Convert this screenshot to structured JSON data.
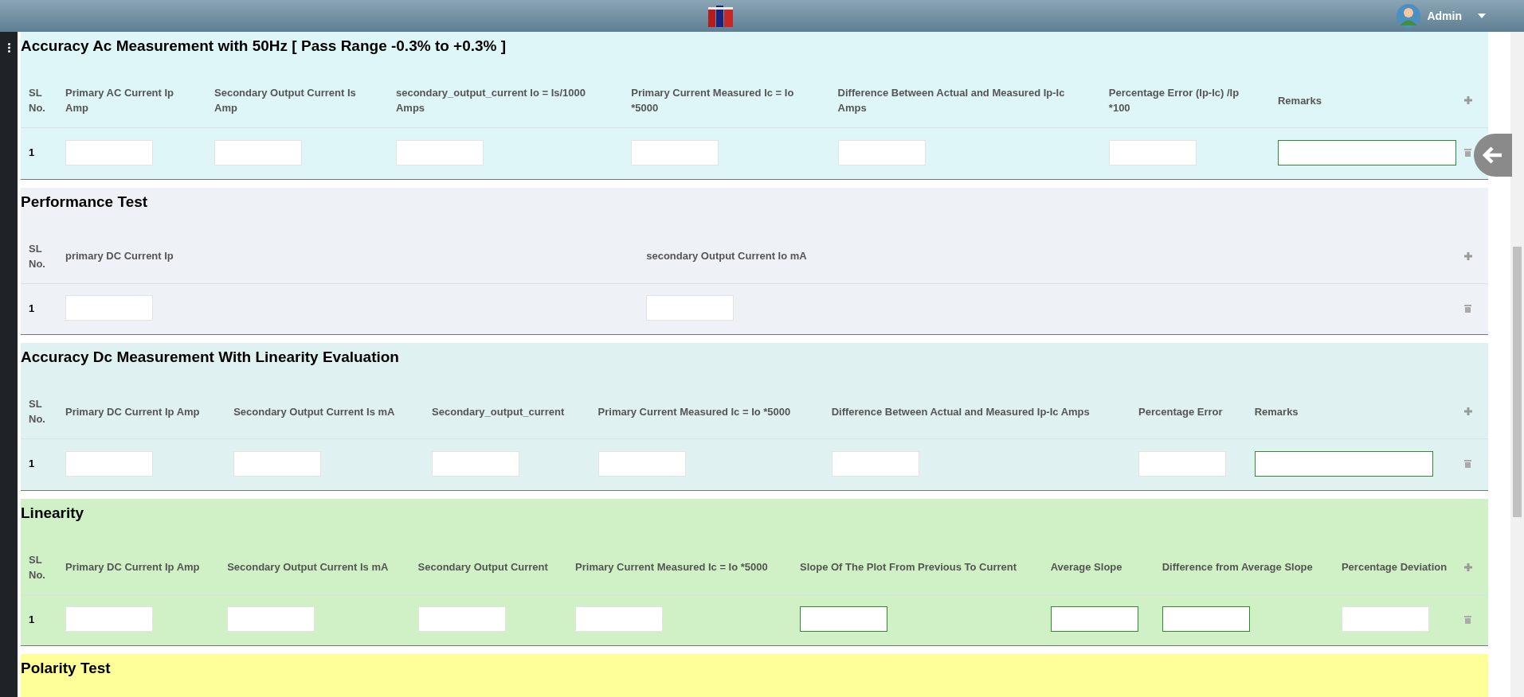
{
  "topbar": {
    "user": "Admin"
  },
  "sections": [
    {
      "title": "Accuracy Ac Measurement with 50Hz [ Pass Range -0.3% to +0.3% ]",
      "color": "#dff6f8",
      "columns": [
        "SL No.",
        "Primary AC Current Ip Amp",
        "Secondary Output Current Is Amp",
        "secondary_output_current Io = Is/1000 Amps",
        "Primary Current Measured Ic = Io *5000",
        "Difference Between Actual and Measured Ip-Ic Amps",
        "Percentage Error (Ip-Ic) /Ip *100",
        "Remarks"
      ],
      "rows": [
        {
          "sl": "1",
          "inputs": [
            {
              "outlined": false
            },
            {
              "outlined": false
            },
            {
              "outlined": false
            },
            {
              "outlined": false
            },
            {
              "outlined": false
            },
            {
              "outlined": false
            },
            {
              "outlined": true,
              "wide": true
            }
          ]
        }
      ]
    },
    {
      "title": "Performance Test",
      "color": "#eef2f7",
      "columns": [
        "SL No.",
        "primary DC Current Ip",
        "secondary Output Current Io mA"
      ],
      "rows": [
        {
          "sl": "1",
          "inputs": [
            {
              "outlined": false
            },
            {
              "outlined": false
            }
          ]
        }
      ]
    },
    {
      "title": "Accuracy Dc Measurement With Linearity Evaluation",
      "color": "#e0f1f1",
      "columns": [
        "SL No.",
        "Primary DC Current Ip Amp",
        "Secondary Output Current Is mA",
        "Secondary_output_current",
        "Primary Current Measured Ic = Io *5000",
        "Difference Between Actual and Measured Ip-Ic Amps",
        "Percentage Error",
        "Remarks"
      ],
      "rows": [
        {
          "sl": "1",
          "inputs": [
            {
              "outlined": false
            },
            {
              "outlined": false
            },
            {
              "outlined": false
            },
            {
              "outlined": false
            },
            {
              "outlined": false
            },
            {
              "outlined": false
            },
            {
              "outlined": true,
              "wide": true
            }
          ]
        }
      ]
    },
    {
      "title": "Linearity",
      "color": "#d0f1c5",
      "columns": [
        "SL No.",
        "Primary DC Current Ip Amp",
        "Secondary Output Current Is mA",
        "Secondary Output Current",
        "Primary Current Measured Ic = Io *5000",
        "Slope Of The Plot From Previous To Current",
        "Average Slope",
        "Difference from Average Slope",
        "Percentage Deviation"
      ],
      "rows": [
        {
          "sl": "1",
          "inputs": [
            {
              "outlined": false
            },
            {
              "outlined": false
            },
            {
              "outlined": false
            },
            {
              "outlined": false
            },
            {
              "outlined": true
            },
            {
              "outlined": true
            },
            {
              "outlined": true
            },
            {
              "outlined": false
            }
          ]
        }
      ]
    },
    {
      "title": "Polarity Test",
      "color": "#ffff99"
    }
  ]
}
